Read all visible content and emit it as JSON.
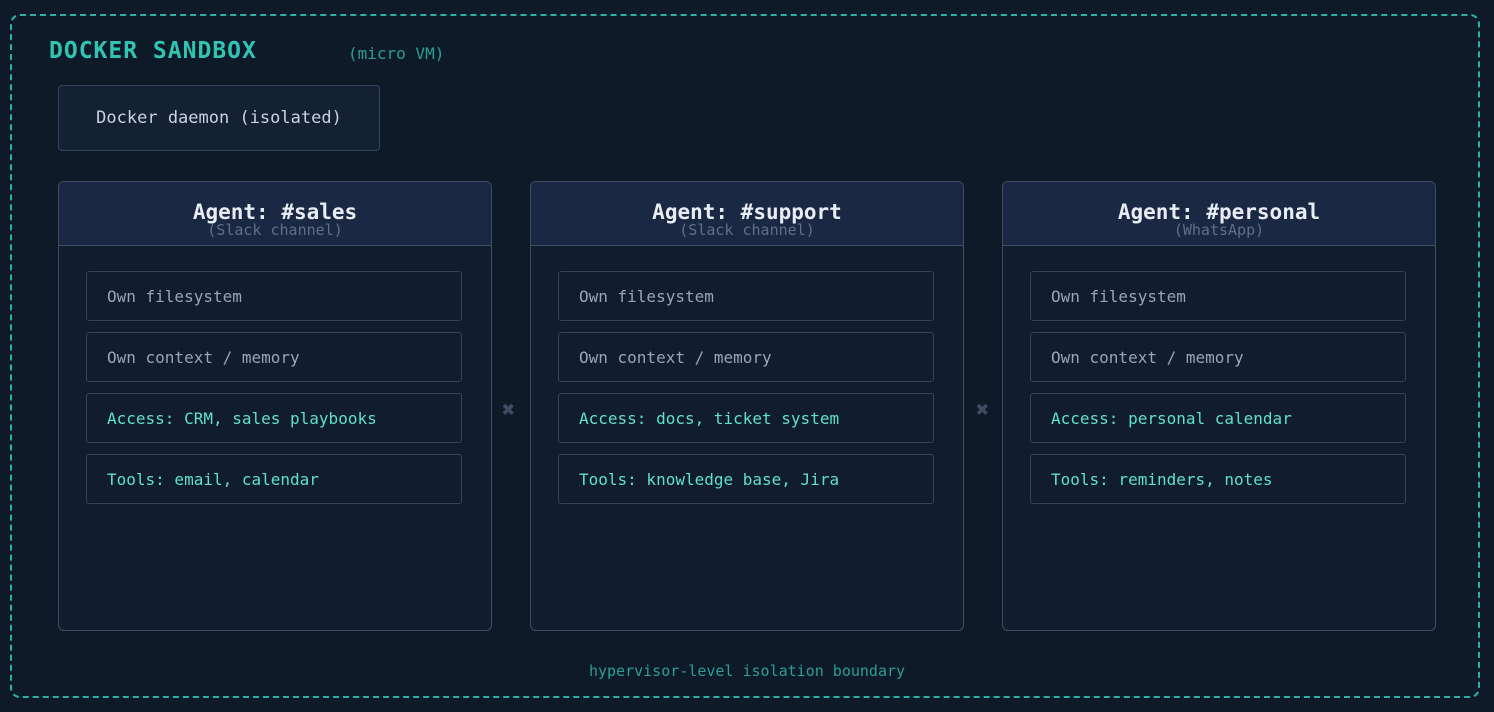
{
  "sandbox": {
    "title": "DOCKER SANDBOX",
    "subtitle": "(micro VM)",
    "daemon_label": "Docker daemon (isolated)",
    "footer": "hypervisor-level isolation boundary",
    "separator_glyph": "✖"
  },
  "agents": [
    {
      "title": "Agent: #sales",
      "subtitle": "(Slack channel)",
      "items": [
        "Own filesystem",
        "Own context / memory",
        "Access: CRM, sales playbooks",
        "Tools: email, calendar"
      ]
    },
    {
      "title": "Agent: #support",
      "subtitle": "(Slack channel)",
      "items": [
        "Own filesystem",
        "Own context / memory",
        "Access: docs, ticket system",
        "Tools: knowledge base, Jira"
      ]
    },
    {
      "title": "Agent: #personal",
      "subtitle": "(WhatsApp)",
      "items": [
        "Own filesystem",
        "Own context / memory",
        "Access: personal calendar",
        "Tools: reminders, notes"
      ]
    }
  ],
  "colors": {
    "background": "#0f1a29",
    "accent": "#31c4b3",
    "border": "#3e4d63",
    "header_fill": "#1a2843"
  }
}
